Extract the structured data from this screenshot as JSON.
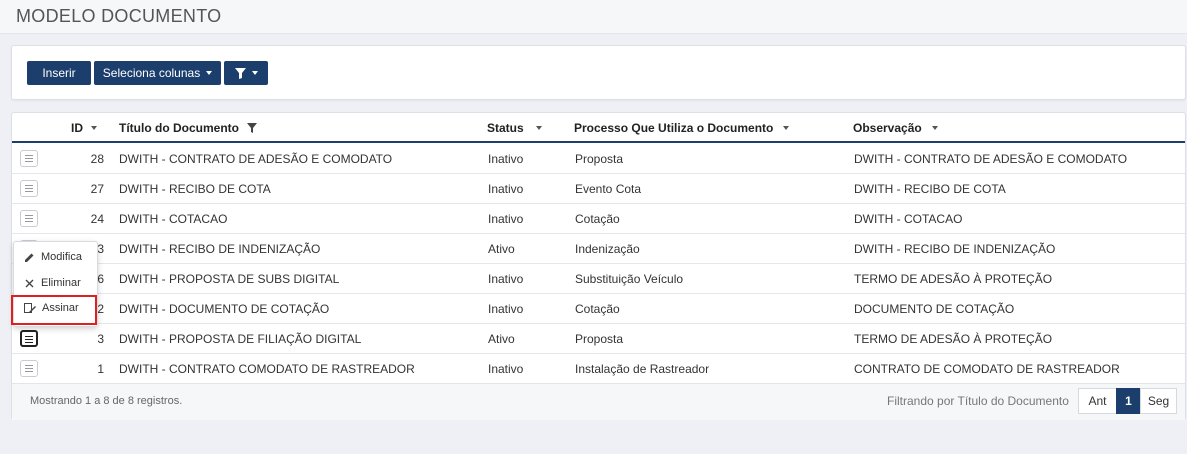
{
  "header": {
    "title": "MODELO DOCUMENTO"
  },
  "toolbar": {
    "insert_label": "Inserir",
    "columns_label": "Seleciona colunas",
    "filter_icon": "filter-icon"
  },
  "table": {
    "columns": {
      "id": "ID",
      "title": "Título do Documento",
      "status": "Status",
      "process": "Processo Que Utiliza o Documento",
      "observation": "Observação"
    },
    "rows": [
      {
        "id": "28",
        "title": "DWITH - CONTRATO DE ADESÃO E COMODATO",
        "status": "Inativo",
        "process": "Proposta",
        "observation": "DWITH - CONTRATO DE ADESÃO E COMODATO"
      },
      {
        "id": "27",
        "title": "DWITH - RECIBO DE COTA",
        "status": "Inativo",
        "process": "Evento Cota",
        "observation": "DWITH - RECIBO DE COTA"
      },
      {
        "id": "24",
        "title": "DWITH - COTACAO",
        "status": "Inativo",
        "process": "Cotação",
        "observation": "DWITH - COTACAO"
      },
      {
        "id": "3",
        "title": "DWITH - RECIBO DE INDENIZAÇÃO",
        "status": "Ativo",
        "process": "Indenização",
        "observation": "DWITH - RECIBO DE INDENIZAÇÃO"
      },
      {
        "id": "6",
        "title": "DWITH - PROPOSTA DE SUBS DIGITAL",
        "status": "Inativo",
        "process": "Substituição Veículo",
        "observation": "TERMO DE ADESÃO À PROTEÇÃO"
      },
      {
        "id": "2",
        "title": "DWITH - DOCUMENTO DE COTAÇÃO",
        "status": "Inativo",
        "process": "Cotação",
        "observation": "DOCUMENTO DE COTAÇÃO"
      },
      {
        "id": "3",
        "title": "DWITH - PROPOSTA DE FILIAÇÃO DIGITAL",
        "status": "Ativo",
        "process": "Proposta",
        "observation": "TERMO DE ADESÃO À PROTEÇÃO"
      },
      {
        "id": "1",
        "title": "DWITH - CONTRATO COMODATO DE RASTREADOR",
        "status": "Inativo",
        "process": "Instalação de Rastreador",
        "observation": "CONTRATO DE COMODATO DE RASTREADOR"
      }
    ]
  },
  "footer": {
    "info": "Mostrando 1 a 8 de 8 registros.",
    "filter_text": "Filtrando por Título do Documento",
    "pager": {
      "prev": "Ant",
      "current": "1",
      "next": "Seg"
    }
  },
  "context_menu": {
    "edit": "Modifica",
    "delete": "Eliminar",
    "sign": "Assinar"
  },
  "colors": {
    "primary": "#1c3e6c",
    "highlight": "#e02020"
  }
}
